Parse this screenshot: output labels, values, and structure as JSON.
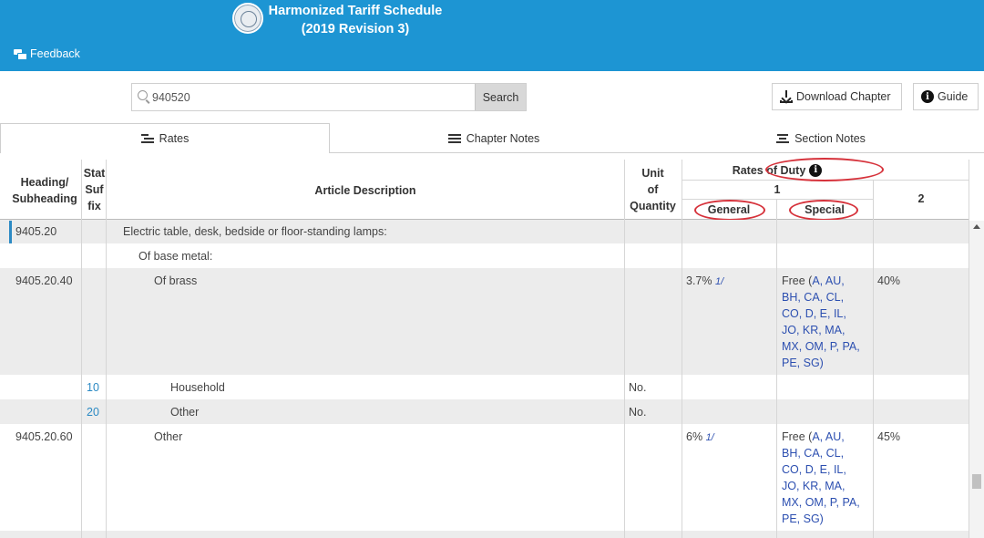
{
  "header": {
    "title_line1": "Harmonized Tariff Schedule",
    "title_line2": "(2019 Revision 3)",
    "feedback_label": "Feedback",
    "background_color": "#1d95d3"
  },
  "search": {
    "value": "940520",
    "button_label": "Search"
  },
  "toolbar": {
    "download_label": "Download Chapter",
    "guide_label": "Guide"
  },
  "tabs": [
    {
      "label": "Rates",
      "active": true
    },
    {
      "label": "Chapter Notes",
      "active": false
    },
    {
      "label": "Section Notes",
      "active": false
    }
  ],
  "table_header": {
    "heading": "Heading/\nSubheading",
    "stat_suffix": "Stat\nSuf\nfix",
    "article_description": "Article Description",
    "unit_of_quantity": "Unit\nof\nQuantity",
    "rates_of_duty": "Rates of Duty",
    "column_1": "1",
    "general": "General",
    "special": "Special",
    "column_2": "2"
  },
  "rows": [
    {
      "heading": "9405.20",
      "stat": "",
      "description": "Electric table, desk, bedside or floor-standing lamps:",
      "unit": "",
      "general": "",
      "special_prefix": "",
      "special_codes": "",
      "col2": ""
    },
    {
      "heading": "",
      "stat": "",
      "description": "Of base metal:",
      "unit": "",
      "general": "",
      "special_prefix": "",
      "special_codes": "",
      "col2": ""
    },
    {
      "heading": "9405.20.40",
      "stat": "",
      "description": "Of brass",
      "unit": "",
      "general": "3.7%",
      "general_footnote": "1/",
      "special_prefix": "Free (",
      "special_codes": "A, AU,\nBH, CA, CL,\nCO, D, E, IL,\nJO, KR, MA,\nMX, OM, P, PA,\nPE, SG)",
      "col2": "40%"
    },
    {
      "heading": "",
      "stat": "10",
      "description": "Household",
      "unit": "No.",
      "general": "",
      "special_prefix": "",
      "special_codes": "",
      "col2": ""
    },
    {
      "heading": "",
      "stat": "20",
      "description": "Other",
      "unit": "No.",
      "general": "",
      "special_prefix": "",
      "special_codes": "",
      "col2": ""
    },
    {
      "heading": "9405.20.60",
      "stat": "",
      "description": "Other",
      "unit": "",
      "general": "6%",
      "general_footnote": "1/",
      "special_prefix": "Free (",
      "special_codes": "A, AU,\nBH, CA, CL,\nCO, D, E, IL,\nJO, KR, MA,\nMX, OM, P, PA,\nPE, SG)",
      "col2": "45%"
    }
  ],
  "colors": {
    "accent": "#2c8ac4",
    "annotation_circle": "#d6323b",
    "link": "#2c4fb0"
  }
}
